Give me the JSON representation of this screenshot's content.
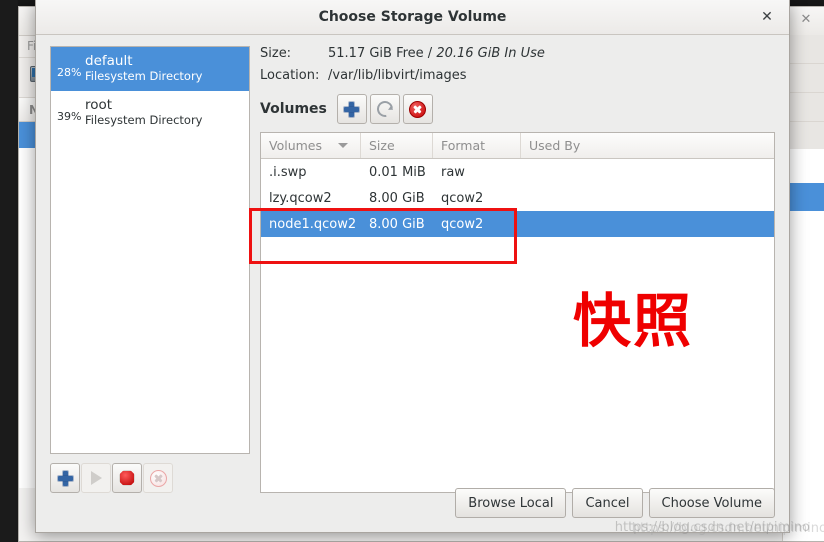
{
  "background_window": {
    "menu_label": "File",
    "column_header": "Nam",
    "close_icon": "close-icon",
    "toolbar_icon": "new-vm-icon"
  },
  "dialog": {
    "title": "Choose Storage Volume",
    "close_label": "✕",
    "pools": [
      {
        "percent": "28%",
        "name": "default",
        "type": "Filesystem Directory",
        "selected": true
      },
      {
        "percent": "39%",
        "name": "root",
        "type": "Filesystem Directory",
        "selected": false
      }
    ],
    "pool_toolbar": [
      {
        "name": "add-pool-button",
        "icon": "plus-icon",
        "enabled": true
      },
      {
        "name": "start-pool-button",
        "icon": "play-icon",
        "enabled": false
      },
      {
        "name": "stop-pool-button",
        "icon": "stop-icon",
        "enabled": true
      },
      {
        "name": "delete-pool-button",
        "icon": "delete-circle-icon",
        "enabled": false
      }
    ],
    "info": {
      "size_label": "Size:",
      "size_free": "51.17 GiB Free / ",
      "size_in_use": "20.16 GiB In Use",
      "location_label": "Location:",
      "location_value": "/var/lib/libvirt/images"
    },
    "volumes_section": {
      "label": "Volumes",
      "buttons": [
        {
          "name": "add-volume-button",
          "icon": "plus-icon"
        },
        {
          "name": "refresh-volumes-button",
          "icon": "refresh-icon"
        },
        {
          "name": "delete-volume-button",
          "icon": "delete-circle-icon"
        }
      ],
      "columns": [
        "Volumes",
        "Size",
        "Format",
        "Used By"
      ],
      "sort_column": "Volumes",
      "rows": [
        {
          "name": ".i.swp",
          "size": "0.01 MiB",
          "format": "raw",
          "used_by": "",
          "selected": false
        },
        {
          "name": "lzy.qcow2",
          "size": "8.00 GiB",
          "format": "qcow2",
          "used_by": "",
          "selected": false
        },
        {
          "name": "node1.qcow2",
          "size": "8.00 GiB",
          "format": "qcow2",
          "used_by": "",
          "selected": true
        }
      ]
    },
    "footer_buttons": [
      {
        "label": "Browse Local",
        "name": "browse-local-button"
      },
      {
        "label": "Cancel",
        "name": "cancel-button"
      },
      {
        "label": "Choose Volume",
        "name": "choose-volume-button"
      }
    ]
  },
  "annotations": {
    "text": "快照",
    "color": "#ef0000",
    "rect_color": "#ee1111"
  },
  "watermark": {
    "text": "https://blog.csdn.net/nipimino"
  },
  "colors": {
    "selection_blue": "#4a90d9",
    "dialog_bg": "#ededec",
    "annotation_red": "#ee1111"
  }
}
